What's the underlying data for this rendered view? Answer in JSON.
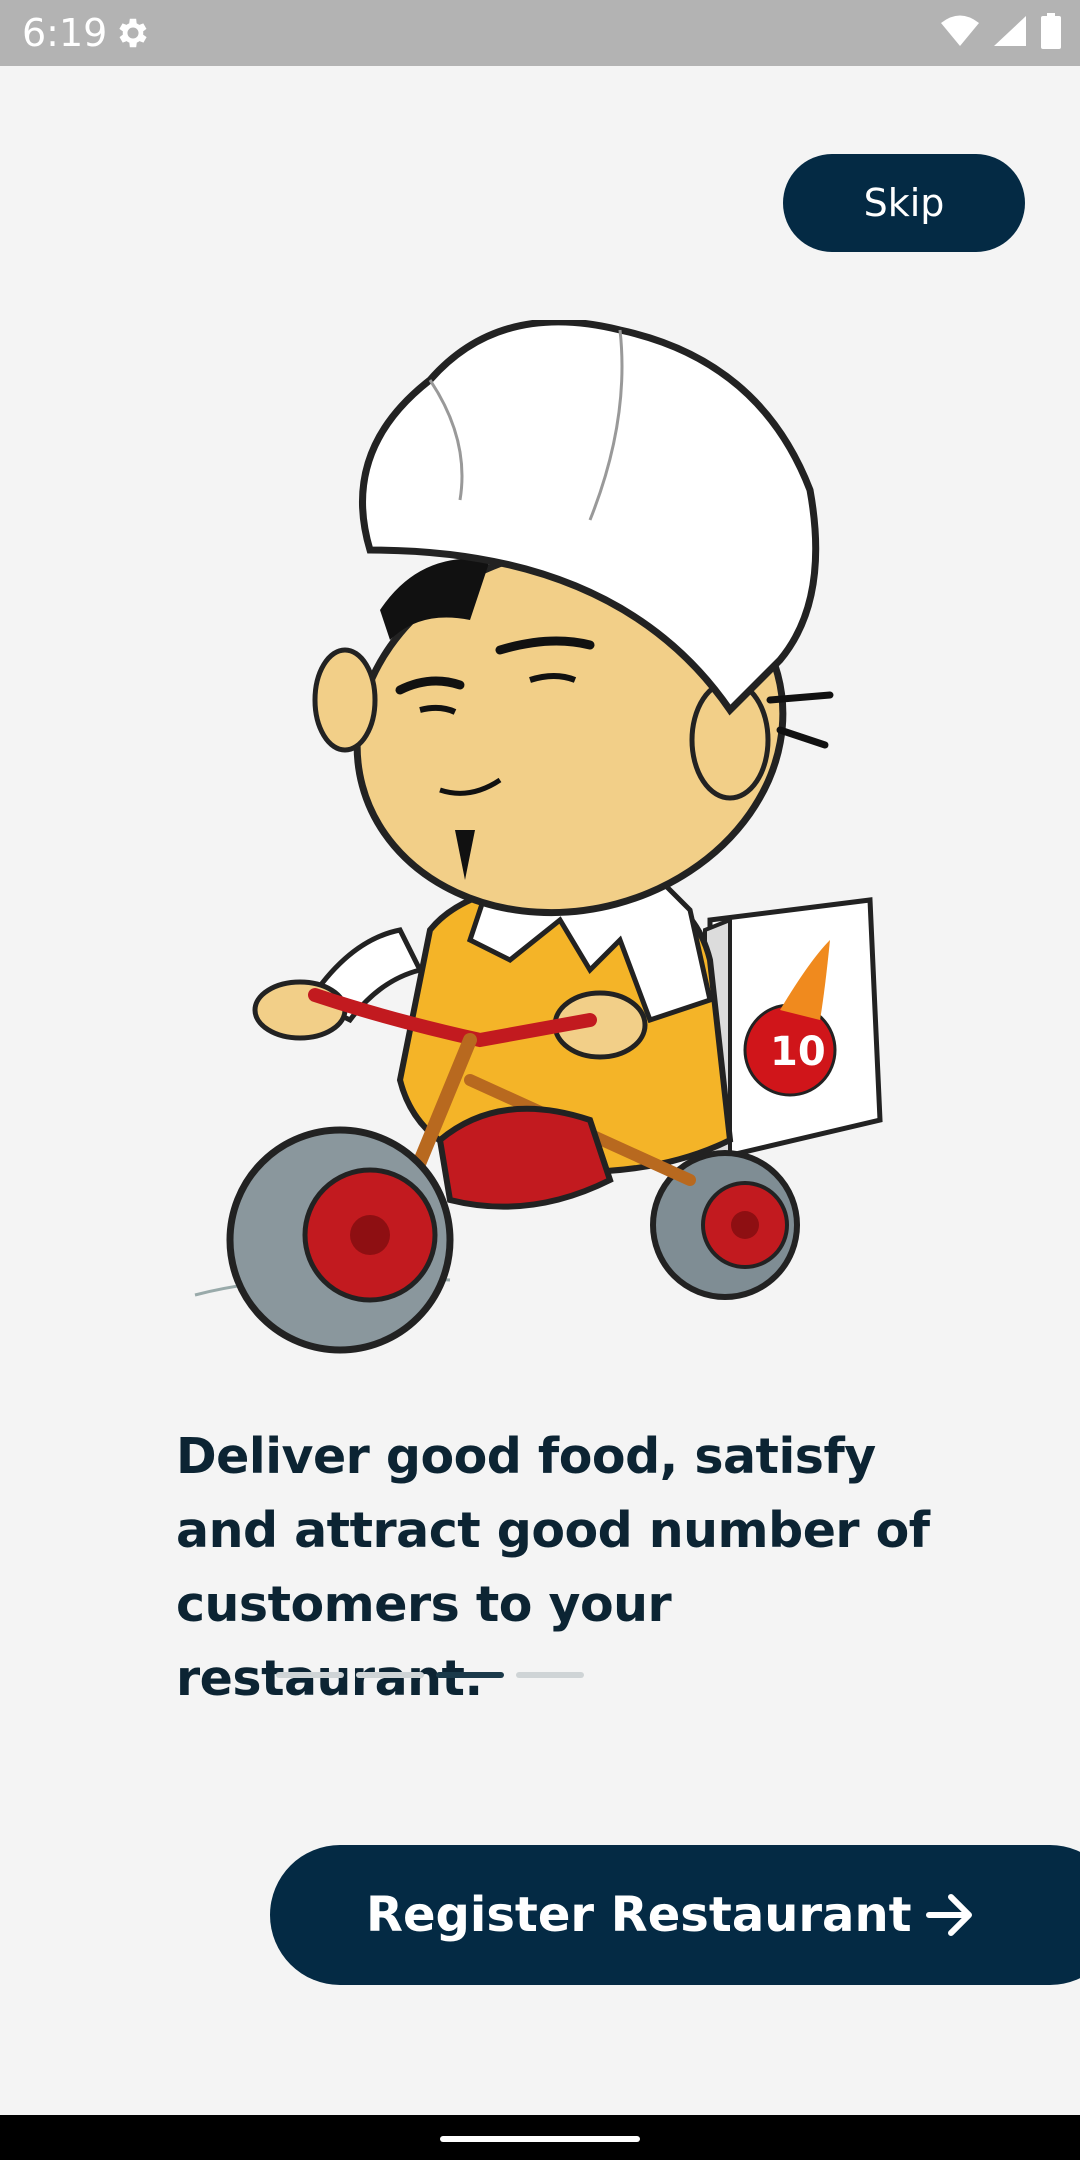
{
  "status_bar": {
    "time": "6:19",
    "icons": [
      "gear-icon",
      "wifi-icon",
      "signal-icon",
      "battery-icon"
    ]
  },
  "onboarding": {
    "skip_label": "Skip",
    "illustration": "chef-riding-tricycle-delivery",
    "headline": "Deliver good food, satisfy and attract good number of customers to your restaurant.",
    "pager": {
      "count": 4,
      "active_index": 2
    },
    "register_label": "Register Restaurant",
    "register_icon": "arrow-right-icon"
  },
  "colors": {
    "primary": "#042a44",
    "background": "#f4f4f4",
    "headline_text": "#0c2433",
    "pager_inactive": "#cfd4d6",
    "pager_active": "#1b3a4a"
  }
}
